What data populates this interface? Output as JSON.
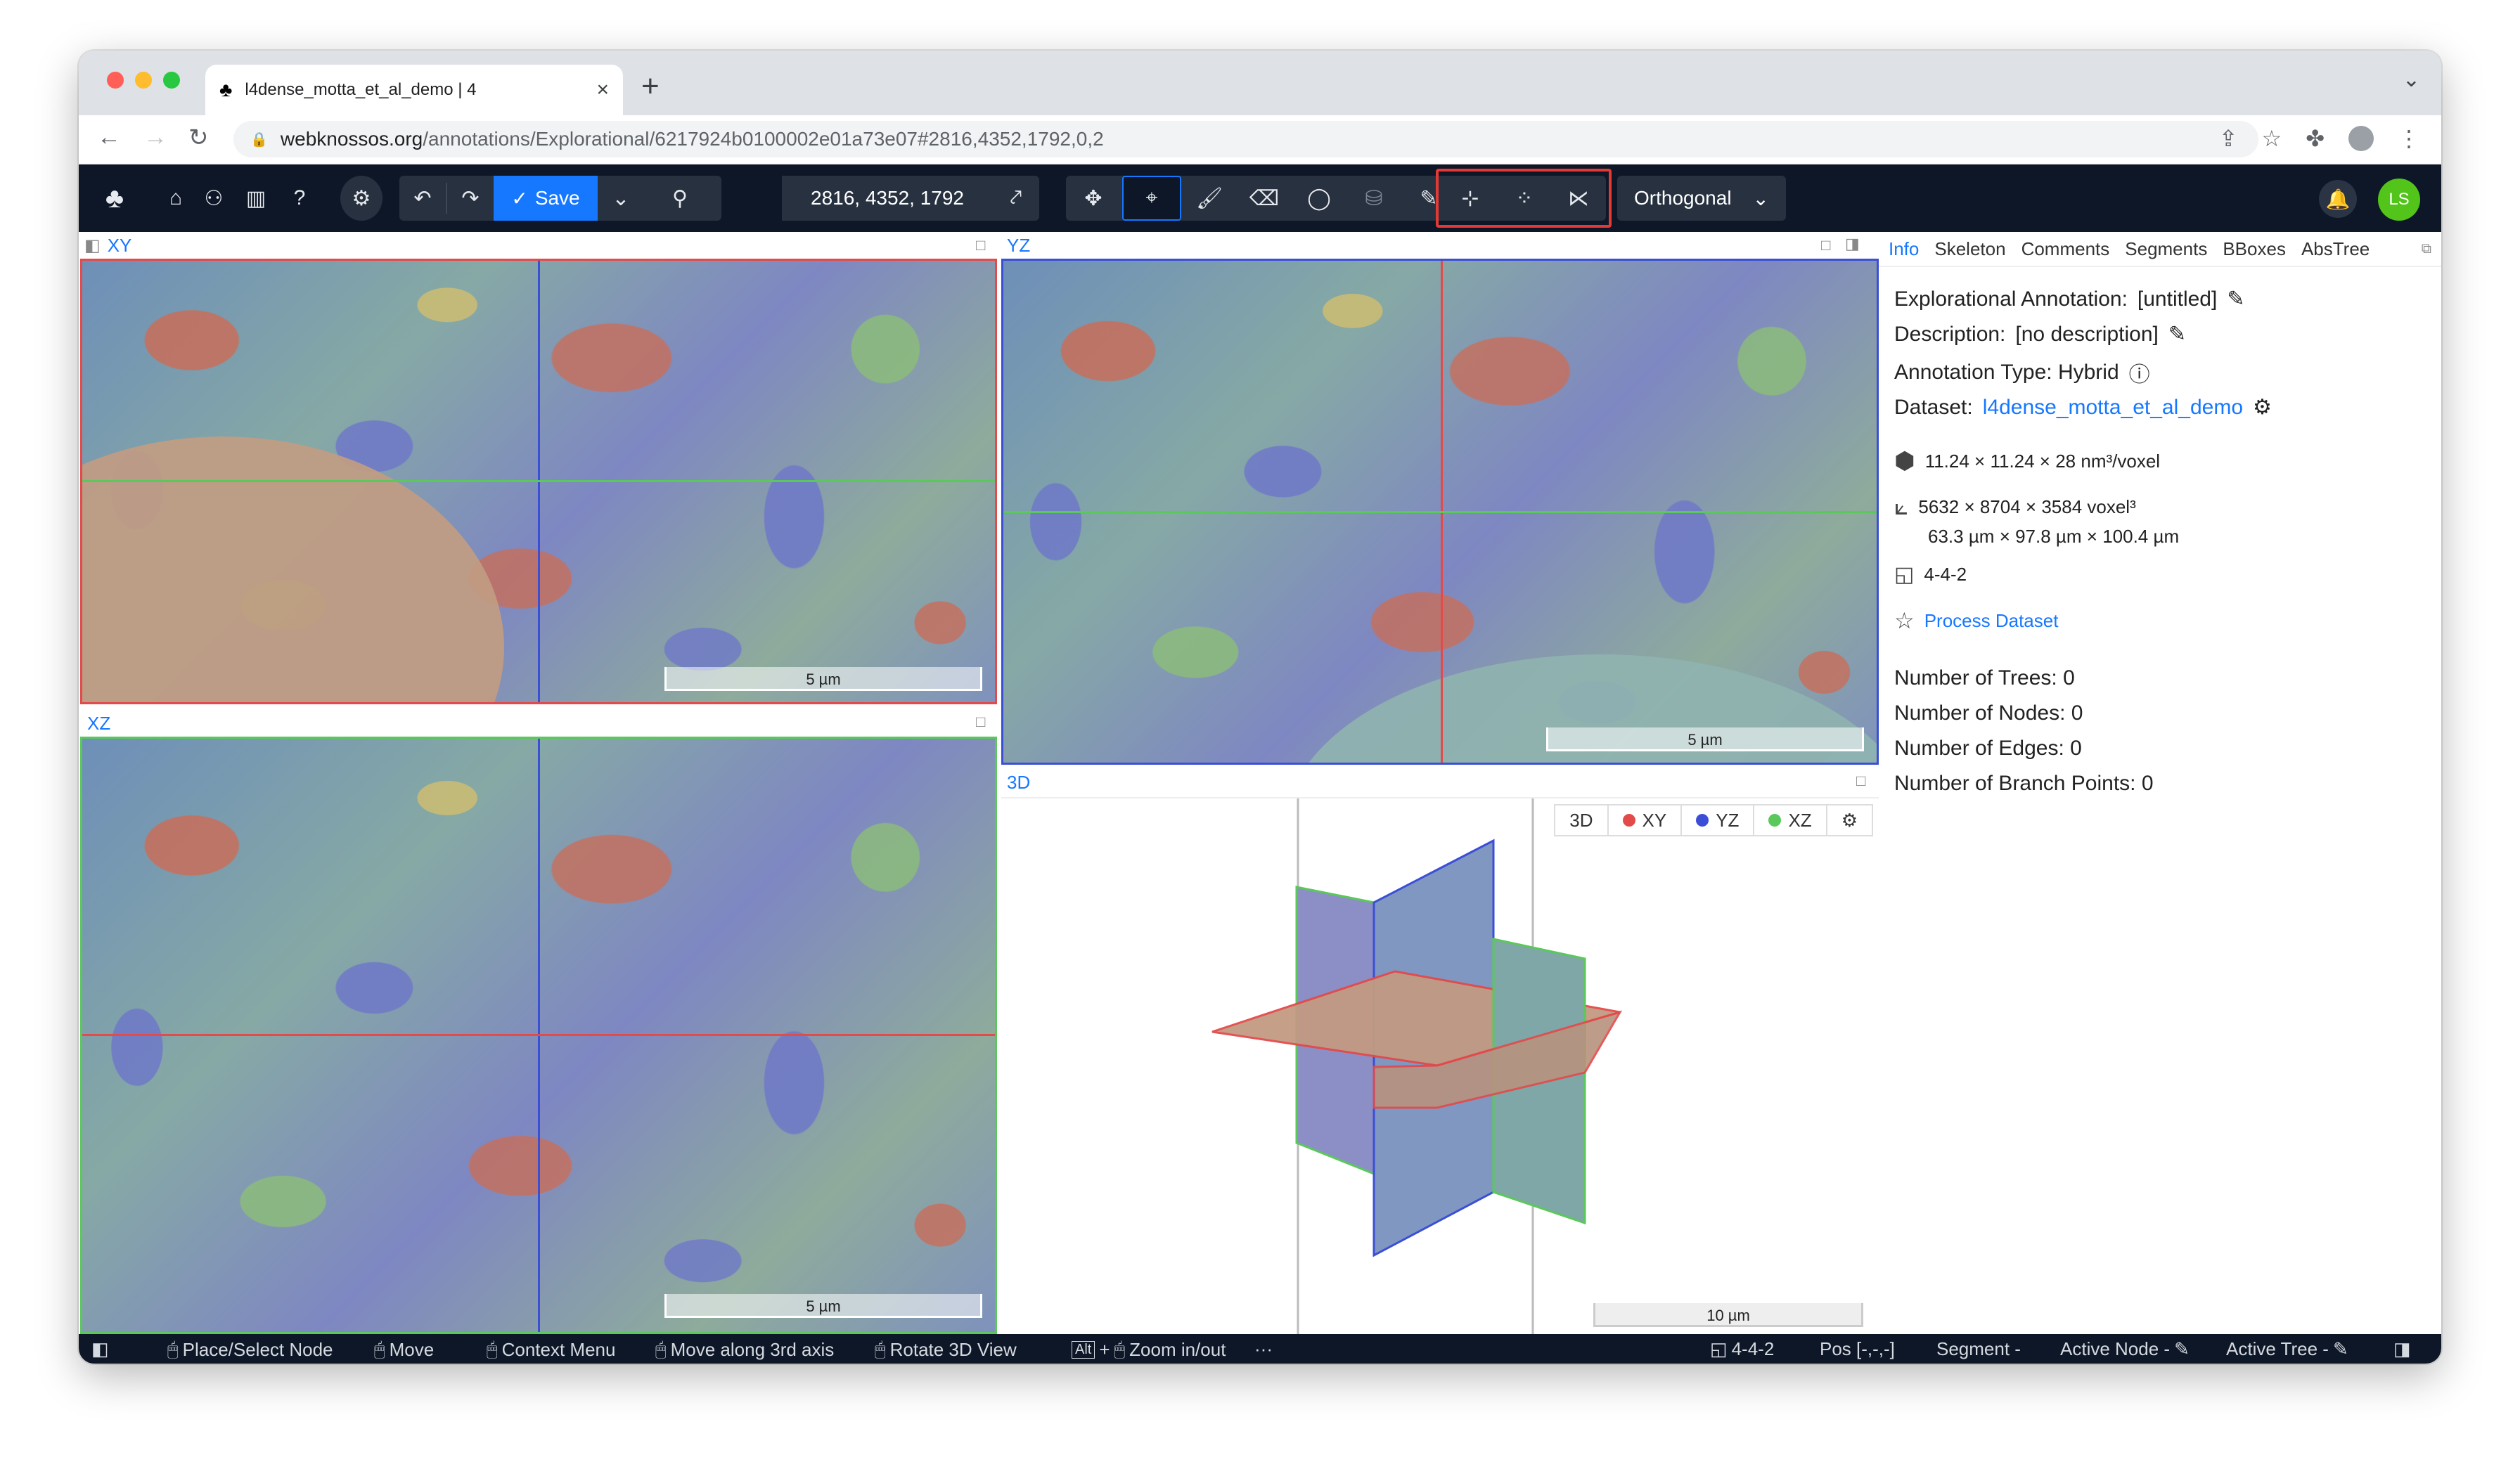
{
  "browser": {
    "tab_title": "l4dense_motta_et_al_demo | 4",
    "url_host": "webknossos.org",
    "url_path": "/annotations/Explorational/6217924b0100002e01a73e07#2816,4352,1792,0,2"
  },
  "toolbar": {
    "save_label": "Save",
    "coordinates": "2816, 4352, 1792",
    "view_mode": "Orthogonal",
    "user_initials": "LS"
  },
  "viewports": {
    "xy": {
      "label": "XY",
      "scale": "5 µm"
    },
    "yz": {
      "label": "YZ",
      "scale": "5 µm"
    },
    "xz": {
      "label": "XZ",
      "scale": "5 µm"
    },
    "td": {
      "label": "3D",
      "scale": "10 µm"
    },
    "td_tabs": [
      "3D",
      "XY",
      "YZ",
      "XZ"
    ]
  },
  "tab_colors": {
    "xy": "#e34a4a",
    "yz": "#3b4fd6",
    "xz": "#5ac85a"
  },
  "panel": {
    "tabs": [
      "Info",
      "Skeleton",
      "Comments",
      "Segments",
      "BBoxes",
      "AbsTree"
    ],
    "annotation_label": "Explorational Annotation:",
    "annotation_value": "[untitled]",
    "description_label": "Description:",
    "description_value": "[no description]",
    "type_label": "Annotation Type: Hybrid",
    "dataset_label": "Dataset:",
    "dataset_value": "l4dense_motta_et_al_demo",
    "voxel_size": "11.24 × 11.24 × 28 nm³/voxel",
    "extent_voxel": "5632 × 8704 × 3584 voxel³",
    "extent_um": "63.3 µm × 97.8 µm × 100.4 µm",
    "mag": "4-4-2",
    "process_dataset": "Process Dataset",
    "num_trees": "Number of Trees: 0",
    "num_nodes": "Number of Nodes: 0",
    "num_edges": "Number of Edges: 0",
    "num_branch_points": "Number of Branch Points: 0"
  },
  "statusbar": {
    "place_node": "Place/Select Node",
    "move": "Move",
    "context_menu": "Context Menu",
    "move_3rd_axis": "Move along 3rd axis",
    "rotate_3d": "Rotate 3D View",
    "alt_key": "Alt",
    "zoom": "Zoom in/out",
    "more": "···",
    "mag": "4-4-2",
    "pos": "Pos [-,-,-]",
    "segment": "Segment -",
    "active_node": "Active Node -",
    "active_tree": "Active Tree -"
  }
}
